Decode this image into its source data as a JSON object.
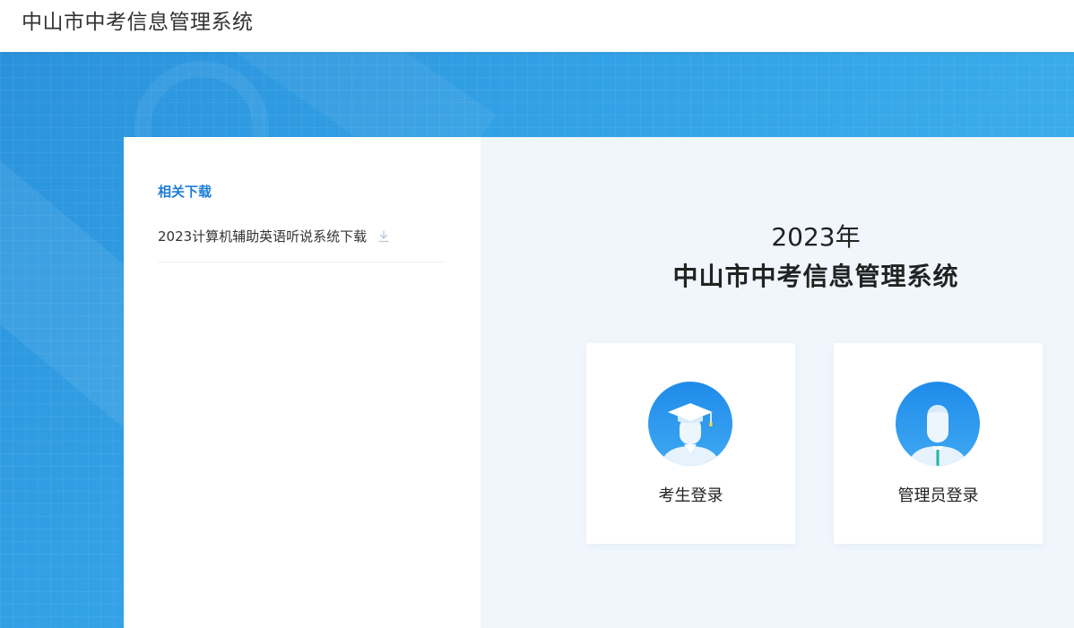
{
  "header": {
    "title": "中山市中考信息管理系统"
  },
  "downloads": {
    "heading": "相关下载",
    "items": [
      {
        "label": "2023计算机辅助英语听说系统下载",
        "icon": "download-icon"
      }
    ]
  },
  "main": {
    "year": "2023年",
    "system_name": "中山市中考信息管理系统",
    "cards": [
      {
        "label": "考生登录",
        "icon": "graduate-avatar-icon"
      },
      {
        "label": "管理员登录",
        "icon": "admin-avatar-icon"
      }
    ]
  },
  "colors": {
    "accent": "#1e7fd6",
    "hero_blue": "#35a6e8",
    "panel_bg": "#f0f6fc"
  }
}
